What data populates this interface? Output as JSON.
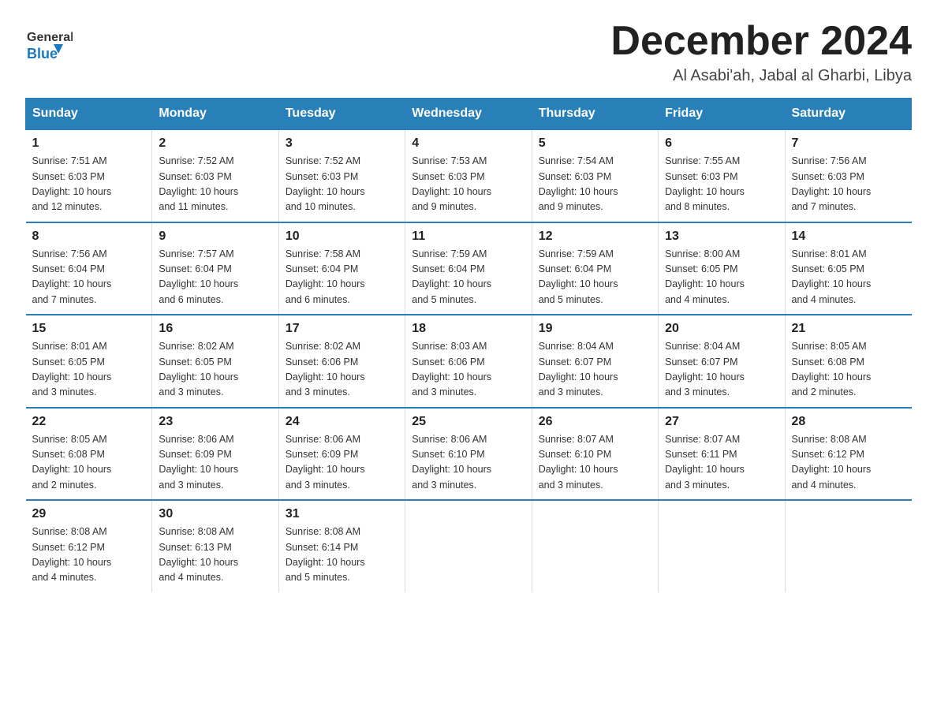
{
  "header": {
    "logo_text_general": "General",
    "logo_text_blue": "Blue",
    "title": "December 2024",
    "subtitle": "Al Asabi'ah, Jabal al Gharbi, Libya"
  },
  "days_of_week": [
    "Sunday",
    "Monday",
    "Tuesday",
    "Wednesday",
    "Thursday",
    "Friday",
    "Saturday"
  ],
  "weeks": [
    [
      {
        "day": "1",
        "sunrise": "7:51 AM",
        "sunset": "6:03 PM",
        "daylight": "10 hours and 12 minutes."
      },
      {
        "day": "2",
        "sunrise": "7:52 AM",
        "sunset": "6:03 PM",
        "daylight": "10 hours and 11 minutes."
      },
      {
        "day": "3",
        "sunrise": "7:52 AM",
        "sunset": "6:03 PM",
        "daylight": "10 hours and 10 minutes."
      },
      {
        "day": "4",
        "sunrise": "7:53 AM",
        "sunset": "6:03 PM",
        "daylight": "10 hours and 9 minutes."
      },
      {
        "day": "5",
        "sunrise": "7:54 AM",
        "sunset": "6:03 PM",
        "daylight": "10 hours and 9 minutes."
      },
      {
        "day": "6",
        "sunrise": "7:55 AM",
        "sunset": "6:03 PM",
        "daylight": "10 hours and 8 minutes."
      },
      {
        "day": "7",
        "sunrise": "7:56 AM",
        "sunset": "6:03 PM",
        "daylight": "10 hours and 7 minutes."
      }
    ],
    [
      {
        "day": "8",
        "sunrise": "7:56 AM",
        "sunset": "6:04 PM",
        "daylight": "10 hours and 7 minutes."
      },
      {
        "day": "9",
        "sunrise": "7:57 AM",
        "sunset": "6:04 PM",
        "daylight": "10 hours and 6 minutes."
      },
      {
        "day": "10",
        "sunrise": "7:58 AM",
        "sunset": "6:04 PM",
        "daylight": "10 hours and 6 minutes."
      },
      {
        "day": "11",
        "sunrise": "7:59 AM",
        "sunset": "6:04 PM",
        "daylight": "10 hours and 5 minutes."
      },
      {
        "day": "12",
        "sunrise": "7:59 AM",
        "sunset": "6:04 PM",
        "daylight": "10 hours and 5 minutes."
      },
      {
        "day": "13",
        "sunrise": "8:00 AM",
        "sunset": "6:05 PM",
        "daylight": "10 hours and 4 minutes."
      },
      {
        "day": "14",
        "sunrise": "8:01 AM",
        "sunset": "6:05 PM",
        "daylight": "10 hours and 4 minutes."
      }
    ],
    [
      {
        "day": "15",
        "sunrise": "8:01 AM",
        "sunset": "6:05 PM",
        "daylight": "10 hours and 3 minutes."
      },
      {
        "day": "16",
        "sunrise": "8:02 AM",
        "sunset": "6:05 PM",
        "daylight": "10 hours and 3 minutes."
      },
      {
        "day": "17",
        "sunrise": "8:02 AM",
        "sunset": "6:06 PM",
        "daylight": "10 hours and 3 minutes."
      },
      {
        "day": "18",
        "sunrise": "8:03 AM",
        "sunset": "6:06 PM",
        "daylight": "10 hours and 3 minutes."
      },
      {
        "day": "19",
        "sunrise": "8:04 AM",
        "sunset": "6:07 PM",
        "daylight": "10 hours and 3 minutes."
      },
      {
        "day": "20",
        "sunrise": "8:04 AM",
        "sunset": "6:07 PM",
        "daylight": "10 hours and 3 minutes."
      },
      {
        "day": "21",
        "sunrise": "8:05 AM",
        "sunset": "6:08 PM",
        "daylight": "10 hours and 2 minutes."
      }
    ],
    [
      {
        "day": "22",
        "sunrise": "8:05 AM",
        "sunset": "6:08 PM",
        "daylight": "10 hours and 2 minutes."
      },
      {
        "day": "23",
        "sunrise": "8:06 AM",
        "sunset": "6:09 PM",
        "daylight": "10 hours and 3 minutes."
      },
      {
        "day": "24",
        "sunrise": "8:06 AM",
        "sunset": "6:09 PM",
        "daylight": "10 hours and 3 minutes."
      },
      {
        "day": "25",
        "sunrise": "8:06 AM",
        "sunset": "6:10 PM",
        "daylight": "10 hours and 3 minutes."
      },
      {
        "day": "26",
        "sunrise": "8:07 AM",
        "sunset": "6:10 PM",
        "daylight": "10 hours and 3 minutes."
      },
      {
        "day": "27",
        "sunrise": "8:07 AM",
        "sunset": "6:11 PM",
        "daylight": "10 hours and 3 minutes."
      },
      {
        "day": "28",
        "sunrise": "8:08 AM",
        "sunset": "6:12 PM",
        "daylight": "10 hours and 4 minutes."
      }
    ],
    [
      {
        "day": "29",
        "sunrise": "8:08 AM",
        "sunset": "6:12 PM",
        "daylight": "10 hours and 4 minutes."
      },
      {
        "day": "30",
        "sunrise": "8:08 AM",
        "sunset": "6:13 PM",
        "daylight": "10 hours and 4 minutes."
      },
      {
        "day": "31",
        "sunrise": "8:08 AM",
        "sunset": "6:14 PM",
        "daylight": "10 hours and 5 minutes."
      },
      null,
      null,
      null,
      null
    ]
  ],
  "labels": {
    "sunrise": "Sunrise:",
    "sunset": "Sunset:",
    "daylight": "Daylight:"
  }
}
